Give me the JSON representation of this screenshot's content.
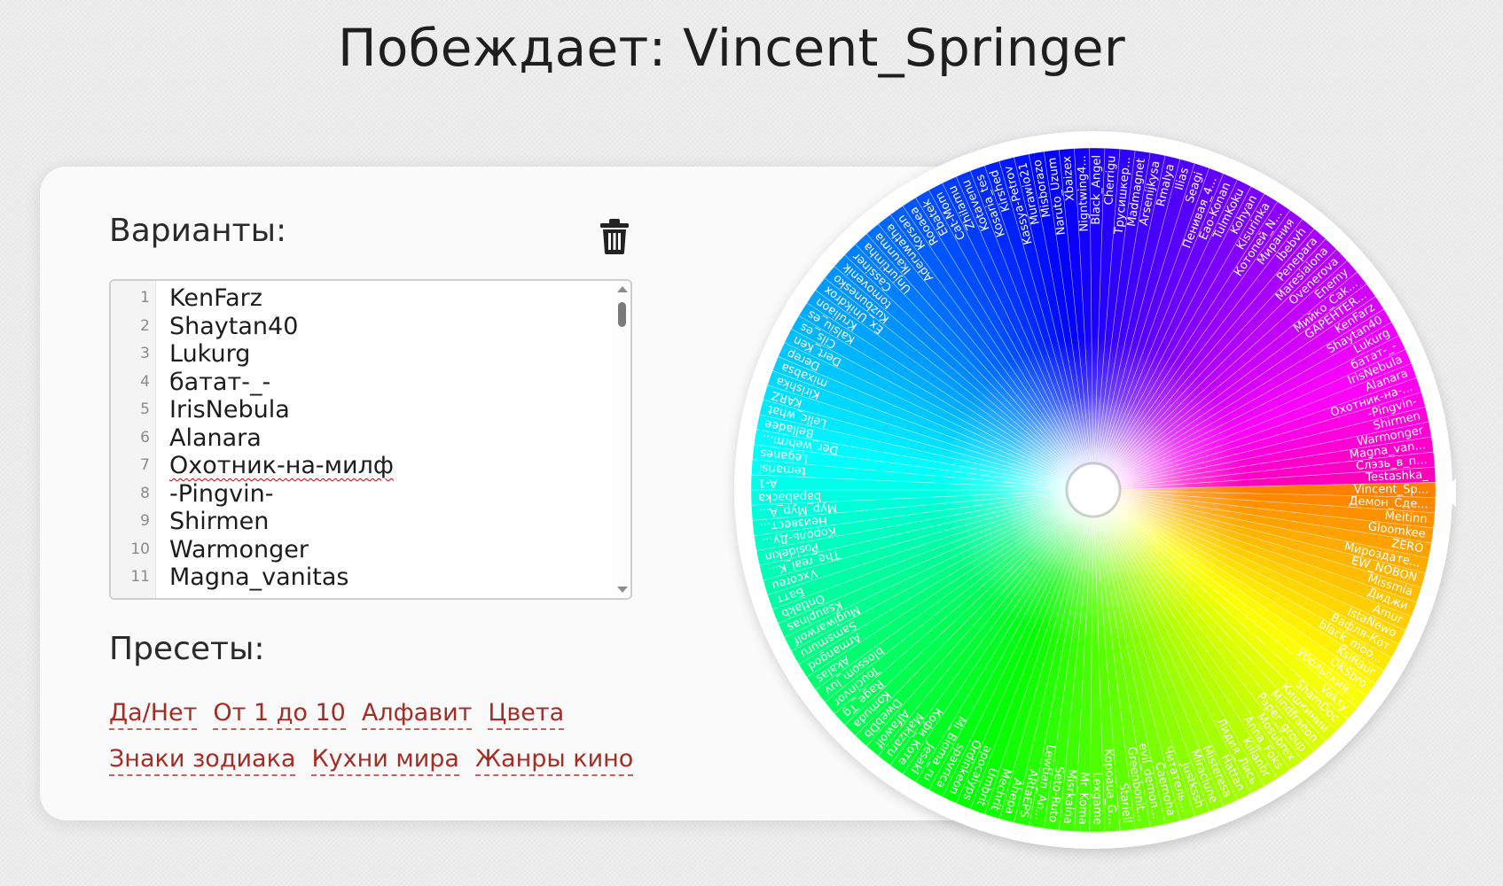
{
  "header": {
    "title": "Побеждает: Vincent_Springer"
  },
  "variants": {
    "label": "Варианты:",
    "lines": [
      {
        "num": "1",
        "text": "KenFarz"
      },
      {
        "num": "2",
        "text": "Shaytan40"
      },
      {
        "num": "3",
        "text": "Lukurg"
      },
      {
        "num": "4",
        "text": "батат-_-"
      },
      {
        "num": "5",
        "text": "IrisNebula"
      },
      {
        "num": "6",
        "text": "Alanara"
      },
      {
        "num": "7",
        "text": "Охотник-на-милф"
      },
      {
        "num": "8",
        "text": "-Pingvin-"
      },
      {
        "num": "9",
        "text": "Shirmen"
      },
      {
        "num": "10",
        "text": "Warmonger"
      },
      {
        "num": "11",
        "text": "Magna_vanitas"
      }
    ]
  },
  "presets": {
    "label": "Пресеты:",
    "row1": [
      "Да/Нет",
      "От 1 до 10",
      "Алфавит",
      "Цвета"
    ],
    "row2": [
      "Знаки зодиака",
      "Кухни мира",
      "Жанры кино"
    ]
  },
  "wheel": {
    "labels": [
      "KenFarz",
      "Shaytan40",
      "Lukurg",
      "батат-_-",
      "IrisNebula",
      "Alanara",
      "Охотник-на-...",
      "-Pingvin-",
      "Shirmen",
      "Warmonger",
      "Magna_van...",
      "Слэзь_в_п...",
      "Testashka_",
      "Vincent_Sp...",
      "Демон_Сде...",
      "Meitinn",
      "Gloomkee",
      "ZERO",
      "Мироздате...",
      "EW_NOBON",
      "Missmia",
      "Диджи",
      "Amur",
      "IstaNewo",
      "Вафля-Кот",
      "black_moo...",
      "KsiRaur",
      "OKSbro",
      "Убольский...",
      "Vaksy",
      "ShamDoc",
      "Кишкинии",
      "Mindfraeon",
      "Paper_group",
      "Mosubrex",
      "Anna_Foks",
      "Killanbr",
      "Лидия_Лись",
      "Hattan",
      "Misteresa",
      "Miraclune",
      "Justkssh",
      "Читатель...",
      "Caemoha",
      "evil_demon...",
      "Greenbonit...",
      "Stariell",
      "Kopoaua_G...",
      "Lexgame",
      "Mr_Koma",
      "Misrkaina",
      "Seto-Ruto",
      "Lewtian_An...",
      "ARtaEPS",
      "Ahepa",
      "Mechrit",
      "Umbrit",
      "apocalyps",
      "Ordinkeon",
      "spavrica",
      "Mi_Bioma_ru",
      "Jesakl",
      "Кофи_Коте",
      "Makizaru",
      "Alfawolf",
      "DwebDb",
      "Komuda",
      "Rage_Tg",
      "Toucinvor",
      "blossom_luv",
      "Akalas",
      "Armangod",
      "Samsmuru",
      "Mugiwarwolf",
      "Ksaupinas",
      "Ontlakb",
      "Батт",
      "Vxcoreu",
      "The_real_K...",
      "Posidekin",
      "Король-Ду...",
      "Неизвест...",
      "Мур_Мур_A...",
      "bapabacka",
      "A-1",
      "temarisi",
      "Leganes",
      "Der_wehrm...",
      "Belladee",
      "Lellc_what",
      "KARZ",
      "Kirishka",
      "mixabsa",
      "Derep",
      "Dert_Ken",
      "Cils_es",
      "Kalsiu_es",
      "Kruliaon",
      "Ex_Unikdrox",
      "Kuzbunesko",
      "tomovenik",
      "Cassiner",
      "Unjurtimha",
      "Ikaunma",
      "Aderuwatha",
      "Korsan",
      "Rooaea",
      "Ebatek",
      "Cat-Mom",
      "Zhilamu",
      "Kotavenu",
      "Kosaria_tes",
      "Kirshed",
      "Kassya-Petrov",
      "Murawio21",
      "Misborazo",
      "Naruto_Uzum",
      "Xbaizex",
      "Nigntwing4...",
      "Black_Angel",
      "Cherrigu",
      "Трусишкер...",
      "Madmagnet",
      "Arsenijkysa",
      "Rmalya",
      "Ilias",
      "Seagi",
      "Пенивая_4...",
      "Eao-Konan",
      "TulmKoku",
      "Kohyan",
      "Kisurinka",
      "Котопей_N...",
      "Мирания",
      "Ibebvh",
      "Penepara",
      "Maresiaiona",
      "Ovenerova",
      "Enemy",
      "Мийко_Cak...",
      "GAPEHTER..."
    ]
  }
}
